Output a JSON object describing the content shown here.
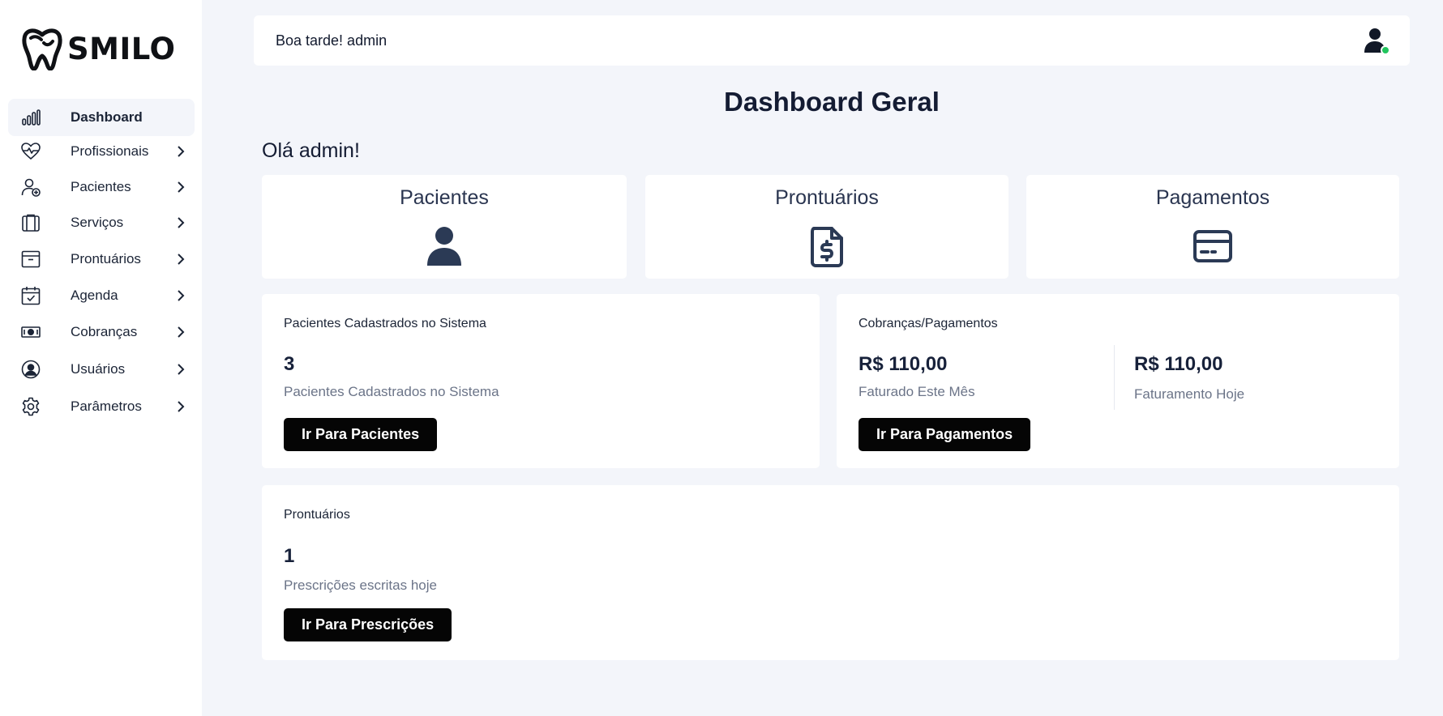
{
  "app": {
    "brand": "SMILO"
  },
  "sidebar": {
    "items": [
      {
        "label": "Dashboard",
        "icon": "bar-chart-icon",
        "active": true
      },
      {
        "label": "Profissionais",
        "icon": "heart-pulse-icon"
      },
      {
        "label": "Pacientes",
        "icon": "user-add-icon"
      },
      {
        "label": "Serviços",
        "icon": "clipboard-icon"
      },
      {
        "label": "Prontuários",
        "icon": "archive-icon"
      },
      {
        "label": "Agenda",
        "icon": "calendar-check-icon"
      },
      {
        "label": "Cobranças",
        "icon": "banknote-icon"
      },
      {
        "label": "Usuários",
        "icon": "user-circle-icon"
      },
      {
        "label": "Parâmetros",
        "icon": "gear-icon"
      }
    ]
  },
  "header": {
    "greeting": "Boa tarde! admin"
  },
  "main": {
    "title": "Dashboard Geral",
    "hello": "Olá admin!",
    "summary": [
      {
        "label": "Pacientes",
        "icon": "user-icon"
      },
      {
        "label": "Prontuários",
        "icon": "file-dollar-icon"
      },
      {
        "label": "Pagamentos",
        "icon": "credit-card-icon"
      }
    ],
    "patients_card": {
      "title": "Pacientes Cadastrados no Sistema",
      "value": "3",
      "label": "Pacientes Cadastrados no Sistema",
      "button": "Ir Para Pacientes"
    },
    "payments_card": {
      "title": "Cobranças/Pagamentos",
      "month_value": "R$ 110,00",
      "month_label": "Faturado Este Mês",
      "today_value": "R$ 110,00",
      "today_label": "Faturamento Hoje",
      "button": "Ir Para Pagamentos"
    },
    "records_card": {
      "title": "Prontuários",
      "value": "1",
      "label": "Prescrições escritas hoje",
      "button": "Ir Para Prescrições"
    }
  },
  "colors": {
    "background": "#f3f5fa",
    "card": "#ffffff",
    "text": "#17213a",
    "muted": "#6b7488",
    "button": "#050505",
    "online": "#22c55e",
    "icon": "#2b3a55"
  }
}
